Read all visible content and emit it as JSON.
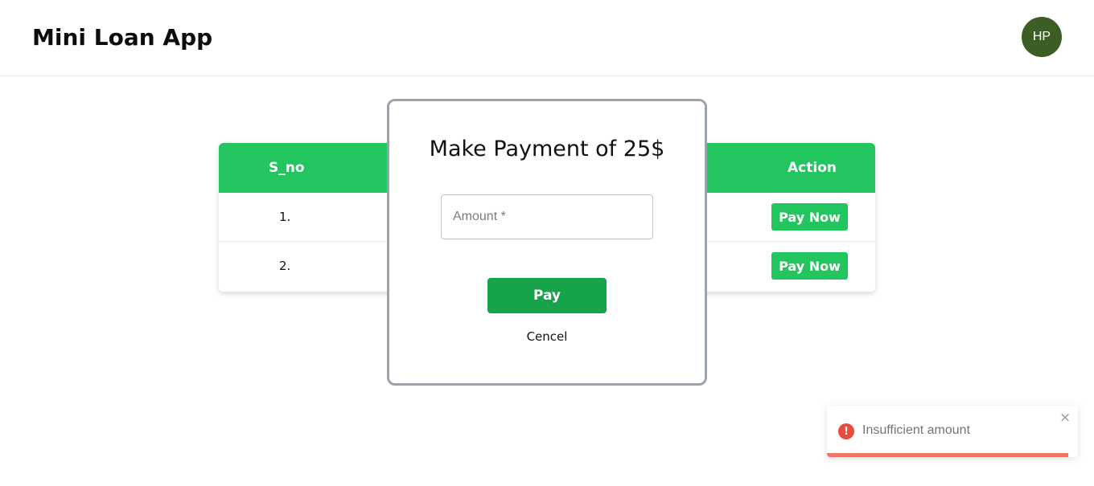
{
  "header": {
    "app_title": "Mini Loan App",
    "avatar_initials": "HP"
  },
  "table": {
    "columns": [
      "S_no",
      "Action"
    ],
    "rows": [
      {
        "sno": "1.",
        "action_label": "Pay Now"
      },
      {
        "sno": "2.",
        "action_label": "Pay Now"
      }
    ]
  },
  "modal": {
    "title": "Make Payment of 25$",
    "amount_placeholder": "Amount *",
    "amount_value": "",
    "pay_label": "Pay",
    "cancel_label": "Cencel"
  },
  "toast": {
    "icon": "error-icon",
    "message": "Insufficient amount",
    "close_glyph": "×",
    "progress_remaining": 0.96
  },
  "colors": {
    "brand_green": "#22c55e",
    "pay_green": "#16a34a",
    "avatar_bg": "#3b5e24",
    "error_red": "#e74c3c"
  }
}
